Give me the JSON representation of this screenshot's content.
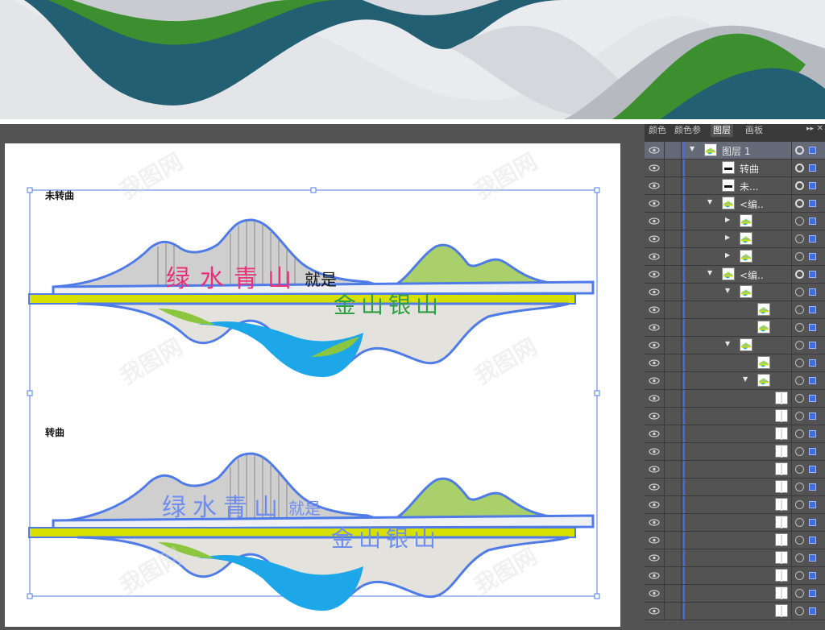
{
  "panel": {
    "tabs": [
      "颜色",
      "颜色参",
      "图层",
      "画板"
    ],
    "active_tab": "图层",
    "layers": [
      {
        "name": "图层 1",
        "twisty": "▼",
        "thumb": "art"
      },
      {
        "name": "转曲",
        "twisty": "",
        "thumb": "text"
      },
      {
        "name": "未...",
        "twisty": "",
        "thumb": "text"
      },
      {
        "name": "<编..",
        "twisty": "▼",
        "thumb": "art"
      },
      {
        "name": "",
        "twisty": "▶",
        "thumb": "art"
      },
      {
        "name": "",
        "twisty": "▶",
        "thumb": "art"
      },
      {
        "name": "",
        "twisty": "▶",
        "thumb": "art"
      },
      {
        "name": "<编..",
        "twisty": "▼",
        "thumb": "art"
      },
      {
        "name": "",
        "twisty": "▼",
        "thumb": "art"
      },
      {
        "name": "",
        "twisty": "",
        "thumb": "art"
      },
      {
        "name": "",
        "twisty": "",
        "thumb": "art"
      },
      {
        "name": "",
        "twisty": "▼",
        "thumb": "art"
      },
      {
        "name": "",
        "twisty": "",
        "thumb": "art"
      },
      {
        "name": "",
        "twisty": "▼",
        "thumb": "art"
      },
      {
        "name": "",
        "twisty": "",
        "thumb": "white"
      },
      {
        "name": "",
        "twisty": "",
        "thumb": "white"
      },
      {
        "name": "",
        "twisty": "",
        "thumb": "white"
      },
      {
        "name": "",
        "twisty": "",
        "thumb": "white"
      },
      {
        "name": "",
        "twisty": "",
        "thumb": "white"
      },
      {
        "name": "",
        "twisty": "",
        "thumb": "white"
      },
      {
        "name": "",
        "twisty": "",
        "thumb": "white"
      },
      {
        "name": "",
        "twisty": "",
        "thumb": "white"
      },
      {
        "name": "",
        "twisty": "",
        "thumb": "white"
      },
      {
        "name": "",
        "twisty": "",
        "thumb": "white"
      },
      {
        "name": "",
        "twisty": "",
        "thumb": "white"
      },
      {
        "name": "",
        "twisty": "",
        "thumb": "white"
      },
      {
        "name": "",
        "twisty": "",
        "thumb": "white"
      }
    ]
  },
  "artboard": {
    "section1_label": "未转曲",
    "section2_label": "转曲",
    "text1": "绿水青山",
    "text1_tail": "就是",
    "text2": "金山银山"
  },
  "watermark": "我图网",
  "colors": {
    "panel_bg": "#535353",
    "selection": "#3b6ee0",
    "yellow": "#d8e000",
    "green": "#8cc63f",
    "cyan": "#1ea7e8",
    "pink": "#e8317a",
    "text_green": "#2f9e44",
    "banner_teal": "#225f72",
    "banner_green": "#3b8f2e"
  }
}
